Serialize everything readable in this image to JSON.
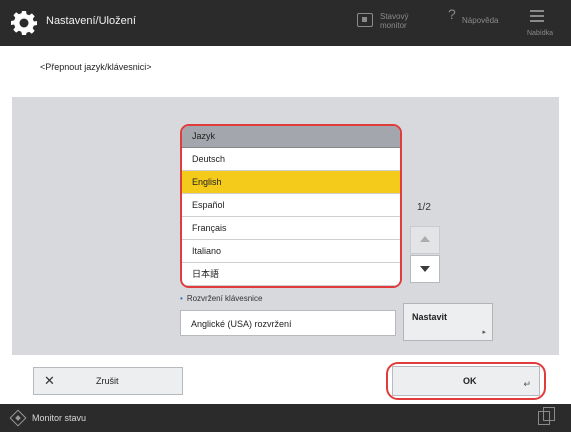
{
  "header": {
    "title": "Nastavení/Uložení",
    "status_btn_label": "Stavový monitor",
    "help_label": "Nápověda",
    "menu_label": "Nabídka"
  },
  "breadcrumb": "<Přepnout jazyk/klávesnici>",
  "language_list": {
    "header": "Jazyk",
    "items": [
      "Deutsch",
      "English",
      "Español",
      "Français",
      "Italiano",
      "日本語"
    ],
    "selected": "English",
    "page_indicator": "1/2"
  },
  "keyboard": {
    "label": "Rozvržení klávesnice",
    "value": "Anglické (USA) rozvržení",
    "set_button": "Nastavit"
  },
  "footer_buttons": {
    "cancel": "Zrušit",
    "ok": "OK"
  },
  "bottom_bar": {
    "monitor": "Monitor stavu"
  },
  "colors": {
    "highlight": "#f4cb1a",
    "callout": "#e03c3c",
    "topbar": "#2b2b2b"
  }
}
